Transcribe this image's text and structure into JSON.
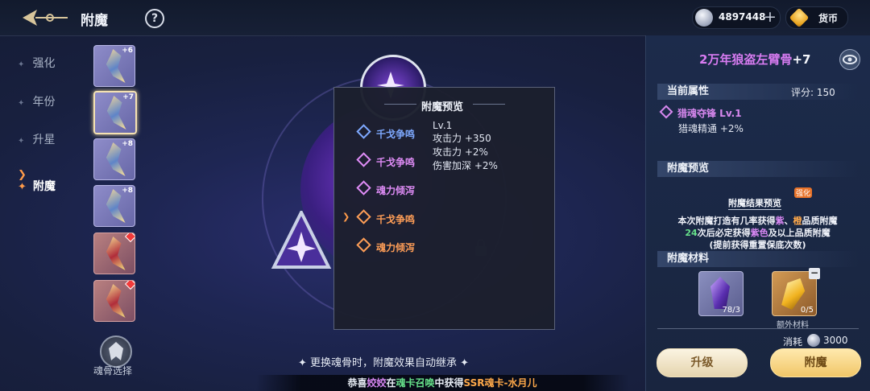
{
  "header": {
    "title": "附魔",
    "help_label": "?",
    "currency": [
      {
        "icon": "silver-coin-icon",
        "value": "4897448"
      },
      {
        "icon": "gold-diamond-icon",
        "value": "货币"
      }
    ]
  },
  "sidebar": {
    "tabs": [
      {
        "label": "强化",
        "active": false
      },
      {
        "label": "年份",
        "active": false
      },
      {
        "label": "升星",
        "active": false
      },
      {
        "label": "附魔",
        "active": true
      }
    ]
  },
  "slots": [
    {
      "level": "+6",
      "variant": "blue",
      "marker": false
    },
    {
      "level": "+7",
      "variant": "blue",
      "marker": false,
      "selected": true
    },
    {
      "level": "+8",
      "variant": "blue",
      "marker": false
    },
    {
      "level": "+8",
      "variant": "blue",
      "marker": false
    },
    {
      "level": "",
      "variant": "red",
      "marker": true
    },
    {
      "level": "",
      "variant": "red",
      "marker": true
    }
  ],
  "soul_select_label": "魂骨选择",
  "preview": {
    "title": "附魔预览",
    "options": [
      {
        "label": "千戈争鸣",
        "color": "#7ea9ff",
        "selected": false
      },
      {
        "label": "千戈争鸣",
        "color": "#df8cf6",
        "selected": false
      },
      {
        "label": "魂力倾泻",
        "color": "#df8cf6",
        "selected": false
      },
      {
        "label": "千戈争鸣",
        "color": "#ff9e57",
        "selected": true
      },
      {
        "label": "魂力倾泻",
        "color": "#ff9e57",
        "selected": false
      }
    ],
    "stats": [
      "Lv.1",
      "攻击力  +350",
      "攻击力  +2%",
      "伤害加深  +2%"
    ]
  },
  "tip": "✦ 更换魂骨时，附魔效果自动继承 ✦",
  "ticker": {
    "prefix": "恭喜",
    "name": "姣姣",
    "mid1": "在",
    "source": "魂卡召唤",
    "mid2": "中获得",
    "reward": "SSR魂卡-水月儿"
  },
  "right": {
    "item_name": "2万年狼盗左臂骨",
    "item_level": "+7",
    "section_attrs": "当前属性",
    "score": "评分: 150",
    "attr_main": "猎魂夺锋 Lv.1",
    "attr_sub": "猎魂精通  +2%",
    "section_preview": "附魔预览",
    "result_title": "附魔结果预览",
    "hot_tag": "强化",
    "line1a": "本次附魔打造有几率获得",
    "line1b": "紫",
    "line1c": "、",
    "line1d": "橙",
    "line1e": "品质附魔",
    "line2a": "24",
    "line2b": "次后必定获得",
    "line2c": "紫色",
    "line2d": "及以上品质附魔",
    "line3": "(提前获得重置保底次数)",
    "section_materials": "附魔材料",
    "mat1_count": "78/3",
    "mat2_count": "0/5",
    "extra_label": "额外材料",
    "cost_label": "消耗",
    "cost_value": "3000",
    "btn_upgrade": "升级",
    "btn_enchant": "附魔"
  }
}
